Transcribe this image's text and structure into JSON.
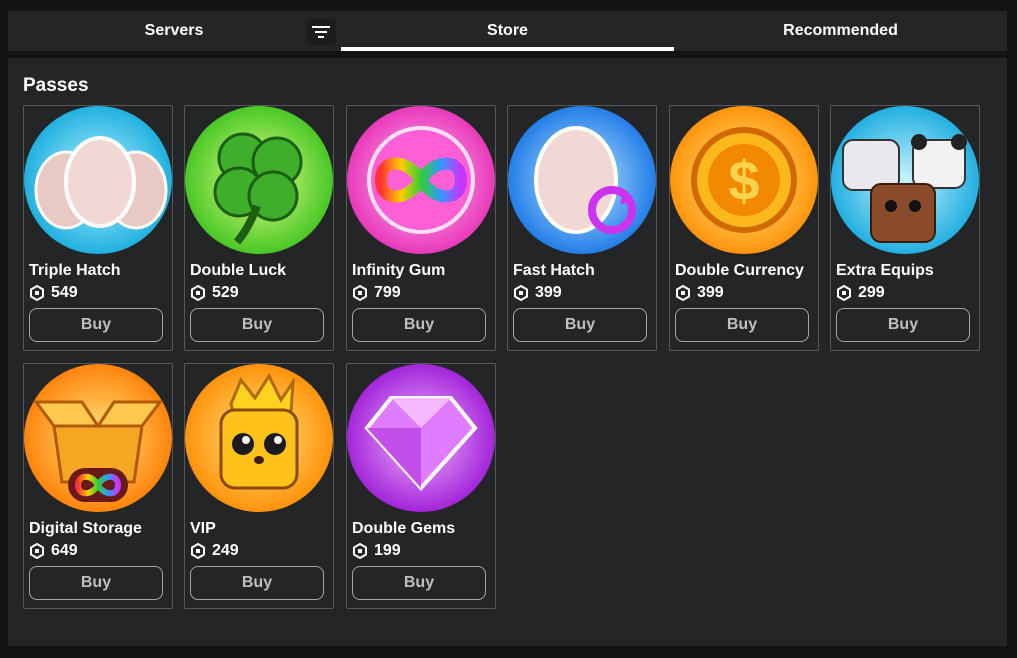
{
  "tabs": {
    "servers": "Servers",
    "store": "Store",
    "recommended": "Recommended"
  },
  "section_title": "Passes",
  "currency_icon": "robux-icon",
  "passes": [
    {
      "name": "Triple Hatch",
      "price": "549",
      "buy_label": "Buy",
      "image": "triple-eggs"
    },
    {
      "name": "Double Luck",
      "price": "529",
      "buy_label": "Buy",
      "image": "four-leaf-clover"
    },
    {
      "name": "Infinity Gum",
      "price": "799",
      "buy_label": "Buy",
      "image": "rainbow-infinity-bubble"
    },
    {
      "name": "Fast Hatch",
      "price": "399",
      "buy_label": "Buy",
      "image": "egg-with-refresh-arrows"
    },
    {
      "name": "Double Currency",
      "price": "399",
      "buy_label": "Buy",
      "image": "gold-dollar-coin"
    },
    {
      "name": "Extra Equips",
      "price": "299",
      "buy_label": "Buy",
      "image": "cat-panda-dog-pets"
    },
    {
      "name": "Digital Storage",
      "price": "649",
      "buy_label": "Buy",
      "image": "open-box-with-infinity"
    },
    {
      "name": "VIP",
      "price": "249",
      "buy_label": "Buy",
      "image": "crowned-yellow-pet"
    },
    {
      "name": "Double Gems",
      "price": "199",
      "buy_label": "Buy",
      "image": "purple-gem"
    }
  ],
  "colors": {
    "page_bg": "#121315",
    "panel_bg": "#232527",
    "card_border": "#55585c",
    "button_text": "#bdbfc1"
  }
}
